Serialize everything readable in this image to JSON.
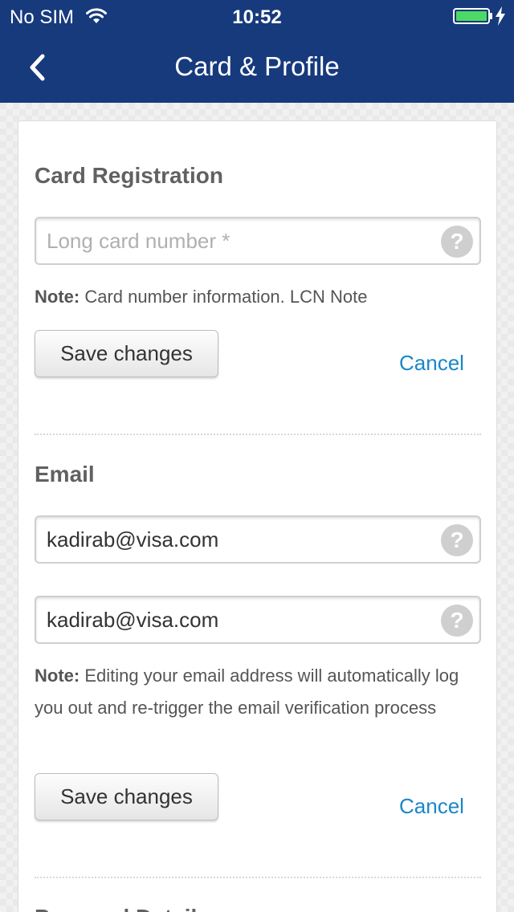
{
  "status": {
    "carrier": "No SIM",
    "time": "10:52"
  },
  "nav": {
    "title": "Card & Profile"
  },
  "card_registration": {
    "title": "Card Registration",
    "card_number_placeholder": "Long card number *",
    "card_number_value": "",
    "note_label": "Note:",
    "note_text": " Card number information. LCN Note",
    "save_label": "Save changes",
    "cancel_label": "Cancel"
  },
  "email": {
    "title": "Email",
    "email_value": "kadirab@visa.com",
    "confirm_email_value": "kadirab@visa.com",
    "note_label": "Note:",
    "note_text": " Editing your email address will automatically log you out and re-trigger the email verification process",
    "save_label": "Save changes",
    "cancel_label": "Cancel"
  },
  "personal_details": {
    "title": "Personal Details"
  },
  "icons": {
    "help": "?"
  },
  "colors": {
    "header": "#173a7d",
    "link": "#1a86c8"
  }
}
